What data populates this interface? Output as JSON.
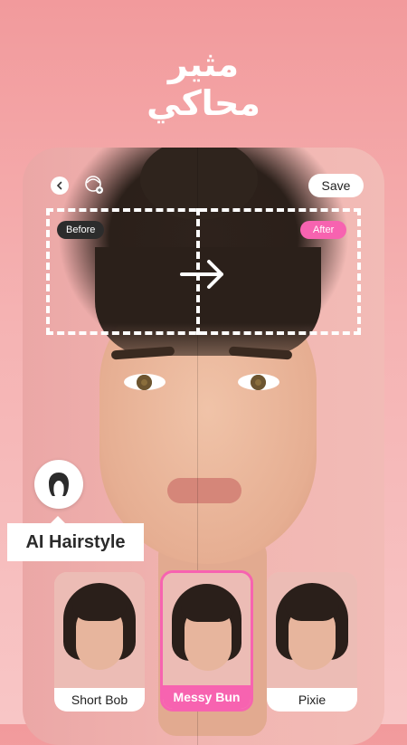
{
  "headline": {
    "line1": "مثير",
    "line2": "محاكي"
  },
  "toolbar": {
    "save_label": "Save"
  },
  "compare": {
    "before_label": "Before",
    "after_label": "After"
  },
  "feature": {
    "label": "AI Hairstyle"
  },
  "styles": [
    {
      "label": "Short Bob",
      "selected": false
    },
    {
      "label": "Messy Bun",
      "selected": true
    },
    {
      "label": "Pixie",
      "selected": false
    }
  ],
  "colors": {
    "accent": "#f763b0",
    "background_top": "#f29a9c",
    "background_bottom": "#f8c6c6"
  }
}
